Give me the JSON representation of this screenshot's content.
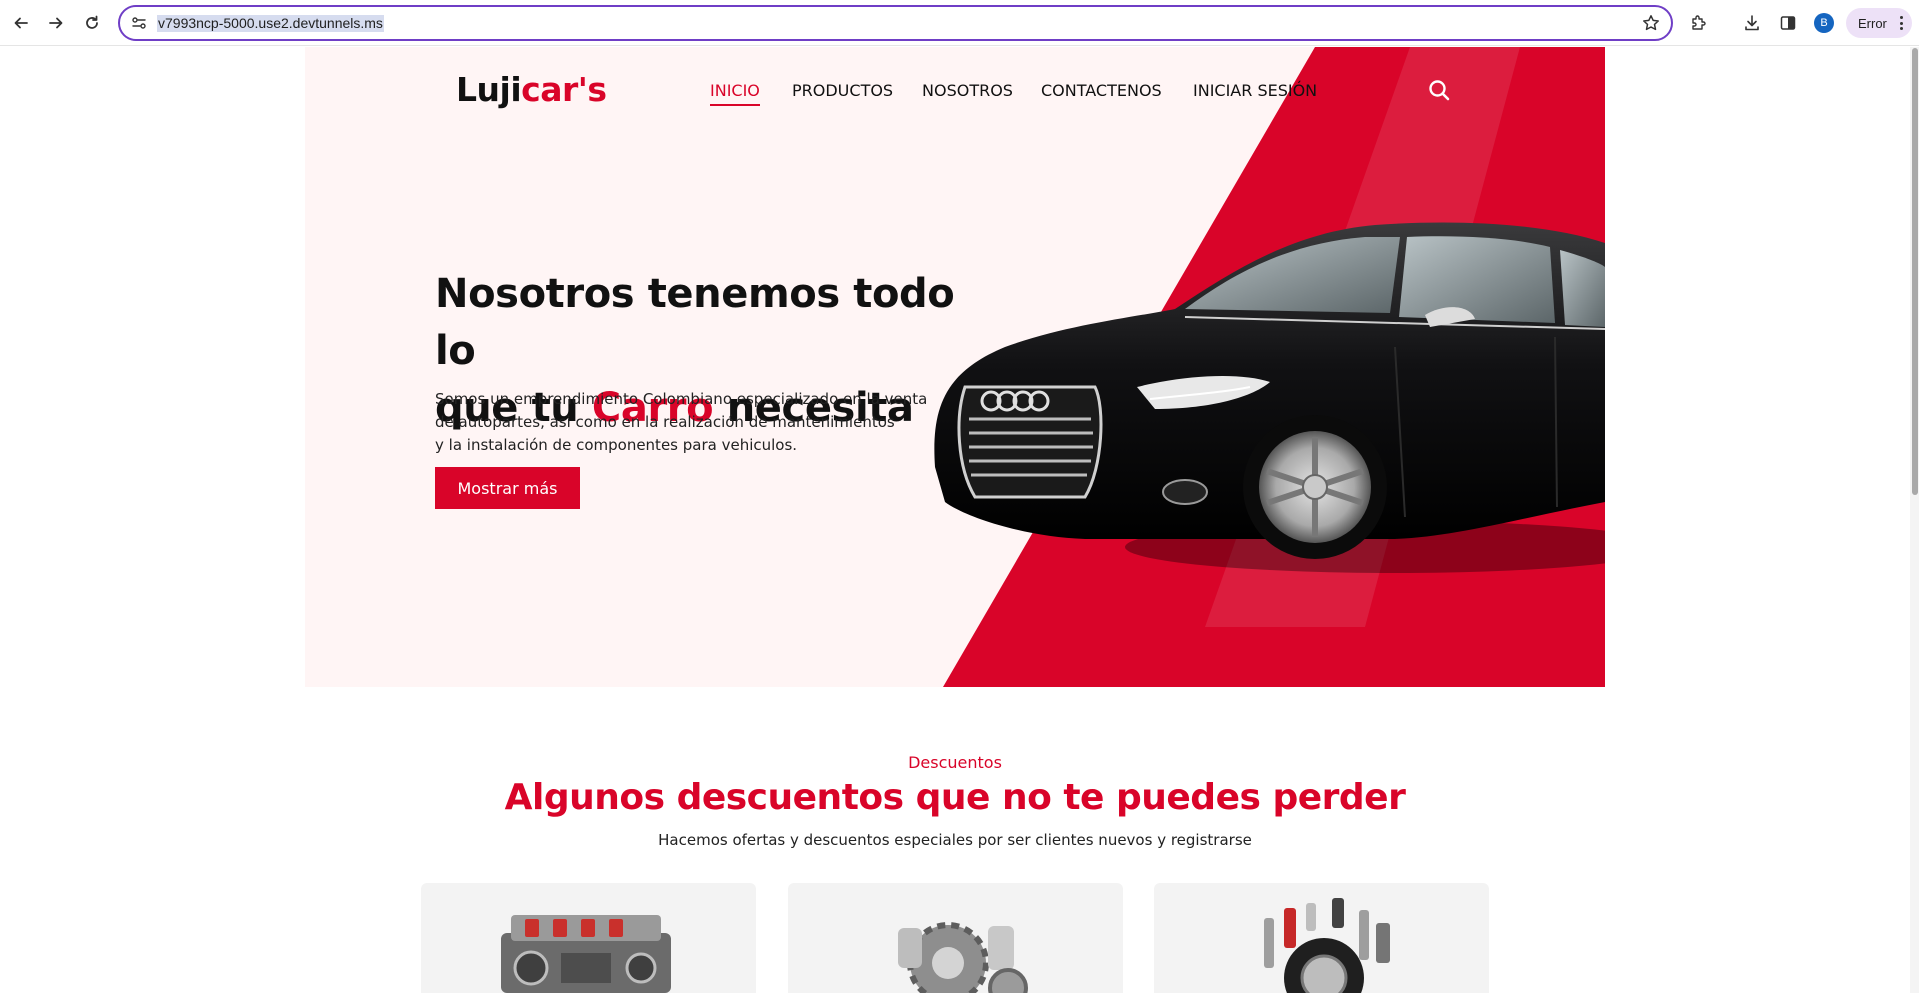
{
  "browser": {
    "url": "v7993ncp-5000.use2.devtunnels.ms",
    "profile_initial": "B",
    "error_label": "Error"
  },
  "site": {
    "logo_main": "Luji",
    "logo_accent": "car's",
    "brand_color": "#d90429",
    "nav": [
      {
        "label": "INICIO",
        "active": true
      },
      {
        "label": "PRODUCTOS",
        "active": false
      },
      {
        "label": "NOSOTROS",
        "active": false
      },
      {
        "label": "CONTACTENOS",
        "active": false
      },
      {
        "label": "INICIAR SESIÓN",
        "active": false
      }
    ]
  },
  "hero": {
    "title_line1": "Nosotros tenemos todo lo",
    "title_line2_pre": "que tu ",
    "title_line2_accent": "Carro",
    "title_line2_post": " necesita",
    "description_line1": "Somos un emprendimiento Colombiano especializado en la venta",
    "description_line2": "de autopartes, asi como en la realización de mantenimientos",
    "description_line3": "y la instalación de componentes para vehiculos.",
    "button_label": "Mostrar más"
  },
  "discounts": {
    "eyebrow": "Descuentos",
    "title": "Algunos descuentos que no te puedes perder",
    "subtitle": "Hacemos ofertas y descuentos especiales por ser clientes nuevos y registrarse",
    "cards": [
      {
        "icon": "engine-icon"
      },
      {
        "icon": "gears-icon"
      },
      {
        "icon": "auto-parts-icon"
      }
    ]
  }
}
